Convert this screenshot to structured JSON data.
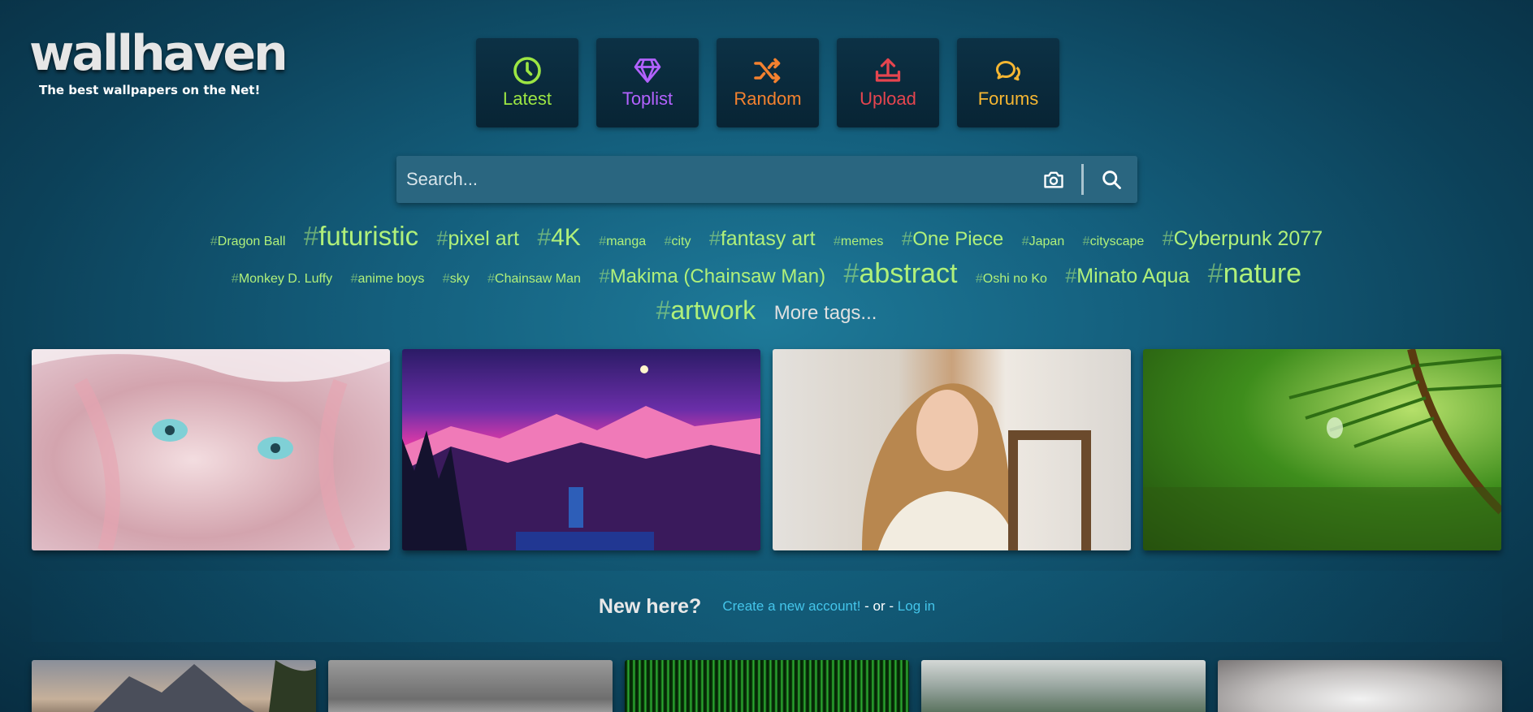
{
  "logo": {
    "title": "wallhaven",
    "tagline": "The best wallpapers on the Net!"
  },
  "nav": [
    {
      "label": "Latest",
      "icon": "clock-icon",
      "color": "#9ce643"
    },
    {
      "label": "Toplist",
      "icon": "gem-icon",
      "color": "#b362ff"
    },
    {
      "label": "Random",
      "icon": "shuffle-icon",
      "color": "#f3812f"
    },
    {
      "label": "Upload",
      "icon": "upload-icon",
      "color": "#e5454f"
    },
    {
      "label": "Forums",
      "icon": "chat-icon",
      "color": "#f7b732"
    }
  ],
  "search": {
    "placeholder": "Search...",
    "camera_icon": "camera-icon",
    "search_icon": "search-icon"
  },
  "tags": {
    "row1": [
      "Dragon Ball",
      "futuristic",
      "pixel art",
      "4K",
      "manga",
      "city",
      "fantasy art",
      "memes",
      "One Piece",
      "Japan",
      "cityscape",
      "Cyberpunk 2077"
    ],
    "row2": [
      "Monkey D. Luffy",
      "anime boys",
      "sky",
      "Chainsaw Man",
      "Makima (Chainsaw Man)",
      "abstract",
      "Oshi no Ko",
      "Minato Aqua",
      "nature"
    ],
    "row3": [
      "artwork"
    ],
    "hash": "#",
    "more": "More tags..."
  },
  "thumbnails": [
    {
      "subject": "anime girl underwater"
    },
    {
      "subject": "purple mountains at night"
    },
    {
      "subject": "woman leaning on chair"
    },
    {
      "subject": "green pine needle macro"
    }
  ],
  "banner": {
    "question": "New here?",
    "create_link": "Create a new account!",
    "or_text": " - or - ",
    "login_link": "Log in"
  },
  "colors": {
    "tag_green": "#b0f07a",
    "link_blue": "#44c5ea"
  }
}
